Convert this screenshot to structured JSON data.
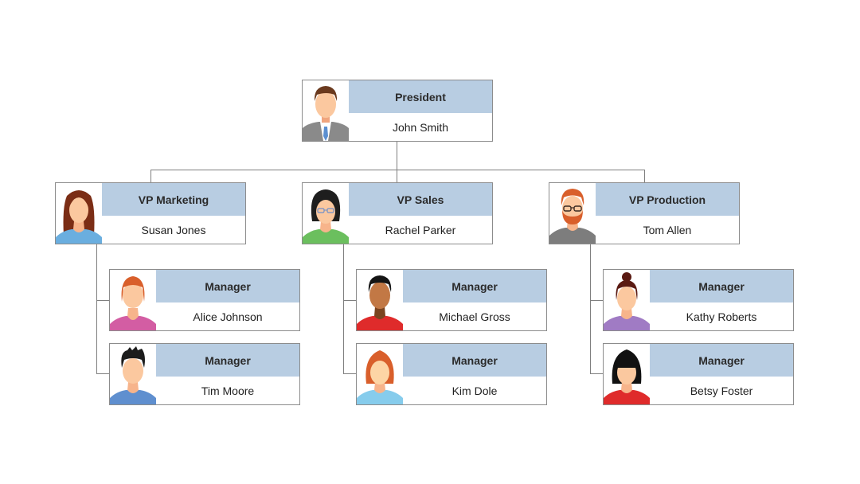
{
  "org_chart": {
    "nodes": [
      {
        "id": "president",
        "title": "President",
        "name": "John Smith",
        "avatar": "man-suit-brown-hair"
      },
      {
        "id": "vp-marketing",
        "title": "VP Marketing",
        "name": "Susan Jones",
        "avatar": "woman-long-auburn-hair"
      },
      {
        "id": "vp-sales",
        "title": "VP Sales",
        "name": "Rachel Parker",
        "avatar": "woman-black-bob-glasses"
      },
      {
        "id": "vp-production",
        "title": "VP Production",
        "name": "Tom Allen",
        "avatar": "man-red-beard-glasses"
      },
      {
        "id": "mgr-alice",
        "title": "Manager",
        "name": "Alice Johnson",
        "avatar": "woman-short-orange-hair"
      },
      {
        "id": "mgr-tim",
        "title": "Manager",
        "name": "Tim Moore",
        "avatar": "man-spiky-black-hair"
      },
      {
        "id": "mgr-michael",
        "title": "Manager",
        "name": "Michael Gross",
        "avatar": "man-dark-skin-black-hair"
      },
      {
        "id": "mgr-kim",
        "title": "Manager",
        "name": "Kim Dole",
        "avatar": "woman-orange-bob"
      },
      {
        "id": "mgr-kathy",
        "title": "Manager",
        "name": "Kathy Roberts",
        "avatar": "woman-hair-bun"
      },
      {
        "id": "mgr-betsy",
        "title": "Manager",
        "name": "Betsy Foster",
        "avatar": "woman-black-bangs"
      }
    ],
    "edges": [
      [
        "president",
        "vp-marketing"
      ],
      [
        "president",
        "vp-sales"
      ],
      [
        "president",
        "vp-production"
      ],
      [
        "vp-marketing",
        "mgr-alice"
      ],
      [
        "vp-marketing",
        "mgr-tim"
      ],
      [
        "vp-sales",
        "mgr-michael"
      ],
      [
        "vp-sales",
        "mgr-kim"
      ],
      [
        "vp-production",
        "mgr-kathy"
      ],
      [
        "vp-production",
        "mgr-betsy"
      ]
    ],
    "colors": {
      "title_band": "#b8cde2",
      "border": "#8c8c8c",
      "connector": "#7f7f7f"
    }
  }
}
